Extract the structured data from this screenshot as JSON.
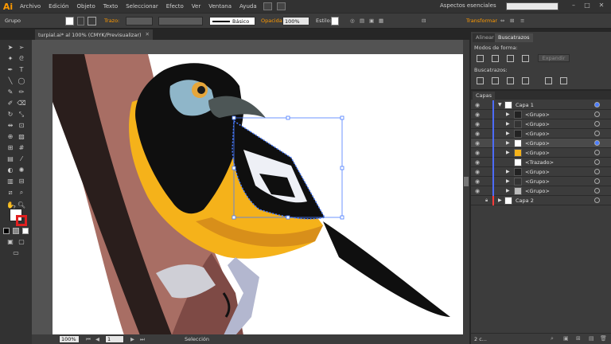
{
  "app": {
    "logo": "Ai",
    "workspace": "Aspectos esenciales"
  },
  "menu": [
    "Archivo",
    "Edición",
    "Objeto",
    "Texto",
    "Seleccionar",
    "Efecto",
    "Ver",
    "Ventana",
    "Ayuda"
  ],
  "control": {
    "selection": "Grupo",
    "stroke_label": "Trazo:",
    "basic_label": "Básico",
    "opacity_label": "Opacidad:",
    "opacity_value": "100%",
    "style_label": "Estilo:",
    "transform_label": "Transformar"
  },
  "document": {
    "tab_title": "turpial.ai* al 100% (CMYK/Previsualizar)"
  },
  "status": {
    "zoom": "100%",
    "page": "1",
    "tool": "Selección"
  },
  "pathfinder": {
    "tab_align": "Alinear",
    "tab_pathfinder": "Buscatrazos",
    "shape_modes_label": "Modos de forma:",
    "expand_label": "Expandir",
    "pathfinders_label": "Buscatrazos:"
  },
  "layers": {
    "tab": "Capas",
    "rows": [
      {
        "name": "Capa 1",
        "level": 0
      },
      {
        "name": "<Grupo>",
        "level": 1
      },
      {
        "name": "<Grupo>",
        "level": 1
      },
      {
        "name": "<Grupo>",
        "level": 1
      },
      {
        "name": "<Grupo>",
        "level": 1
      },
      {
        "name": "<Grupo>",
        "level": 1
      },
      {
        "name": "<Trazado>",
        "level": 1
      },
      {
        "name": "<Grupo>",
        "level": 1
      },
      {
        "name": "<Grupo>",
        "level": 1
      },
      {
        "name": "<Grupo>",
        "level": 1
      },
      {
        "name": "Capa 2",
        "level": 0
      }
    ],
    "count": "2 c..."
  },
  "colors": {
    "accent": "#ff9a00",
    "selection": "#4a7cff",
    "layer1": "#4d6cff",
    "layer2": "#ff3b3b"
  }
}
